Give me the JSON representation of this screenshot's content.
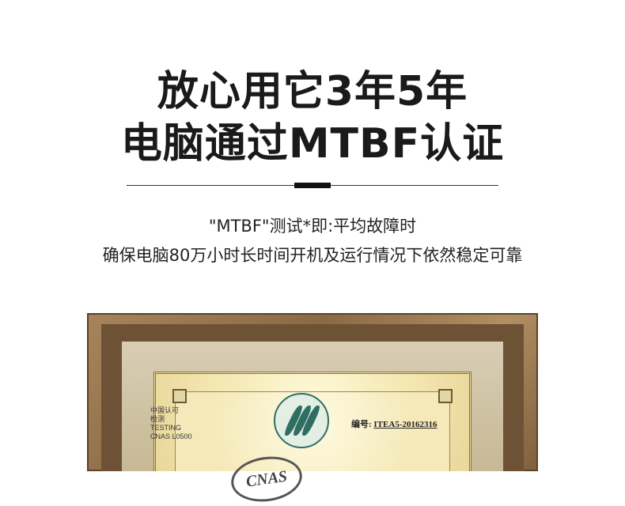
{
  "heading": {
    "line1": "放心用它3年5年",
    "line2": "电脑通过MTBF认证"
  },
  "description": {
    "line1": "\"MTBF\"测试*即:平均故障时",
    "line2": "确保电脑80万小时长时间开机及运行情况下依然稳定可靠"
  },
  "certificate": {
    "cnas_logo_text": "CNAS",
    "cnas_caption": [
      "中国认可",
      "检测",
      "TESTING",
      "CNAS L0500"
    ],
    "number_label": "编号:",
    "number_value": "ITEA5-20162316"
  },
  "icons": [
    "cnas-logo",
    "ilac-logo"
  ]
}
